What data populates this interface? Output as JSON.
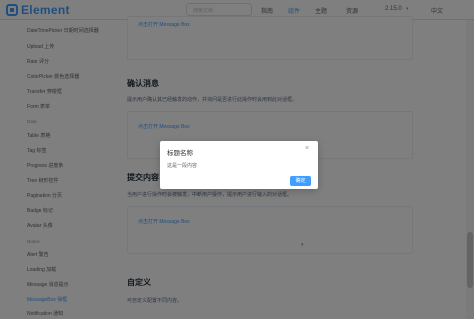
{
  "header": {
    "logo_text": "Element",
    "search_placeholder": "搜索文档",
    "nav": [
      "指南",
      "组件",
      "主题",
      "资源"
    ],
    "version": "2.15.0",
    "lang": "中文"
  },
  "sidebar": {
    "items_top": [
      "DateTimePicker 日期时间选择器",
      "Upload 上传",
      "Rate 评分",
      "ColorPicker 颜色选择器",
      "Transfer 穿梭框",
      "Form 表单"
    ],
    "group_data": "Data",
    "items_data": [
      "Table 表格",
      "Tag 标签",
      "Progress 进度条",
      "Tree 树形控件",
      "Pagination 分页",
      "Badge 标记",
      "Avatar 头像"
    ],
    "group_notice": "Notice",
    "items_notice": [
      "Alert 警告",
      "Loading 加载",
      "Message 消息提示",
      "MessageBox 弹框",
      "Notification 通知"
    ]
  },
  "main": {
    "top_link": "点击打开 Message Box",
    "confirm_title": "确认消息",
    "confirm_desc": "提示用户确认其已经触发的动作，并询问是否进行此操作时会用到此对话框。",
    "confirm_link": "点击打开 Message Box",
    "prompt_title": "提交内容",
    "prompt_desc": "当用户进行操作时会被触发，中断用户操作，提示用户进行输入的对话框。",
    "prompt_link": "点击打开 Message Box",
    "custom_title": "自定义",
    "custom_desc": "可自定义配置不同内容。"
  },
  "messagebox": {
    "title": "标题名称",
    "message": "这是一段内容",
    "confirm": "确定",
    "close_icon": "×"
  }
}
